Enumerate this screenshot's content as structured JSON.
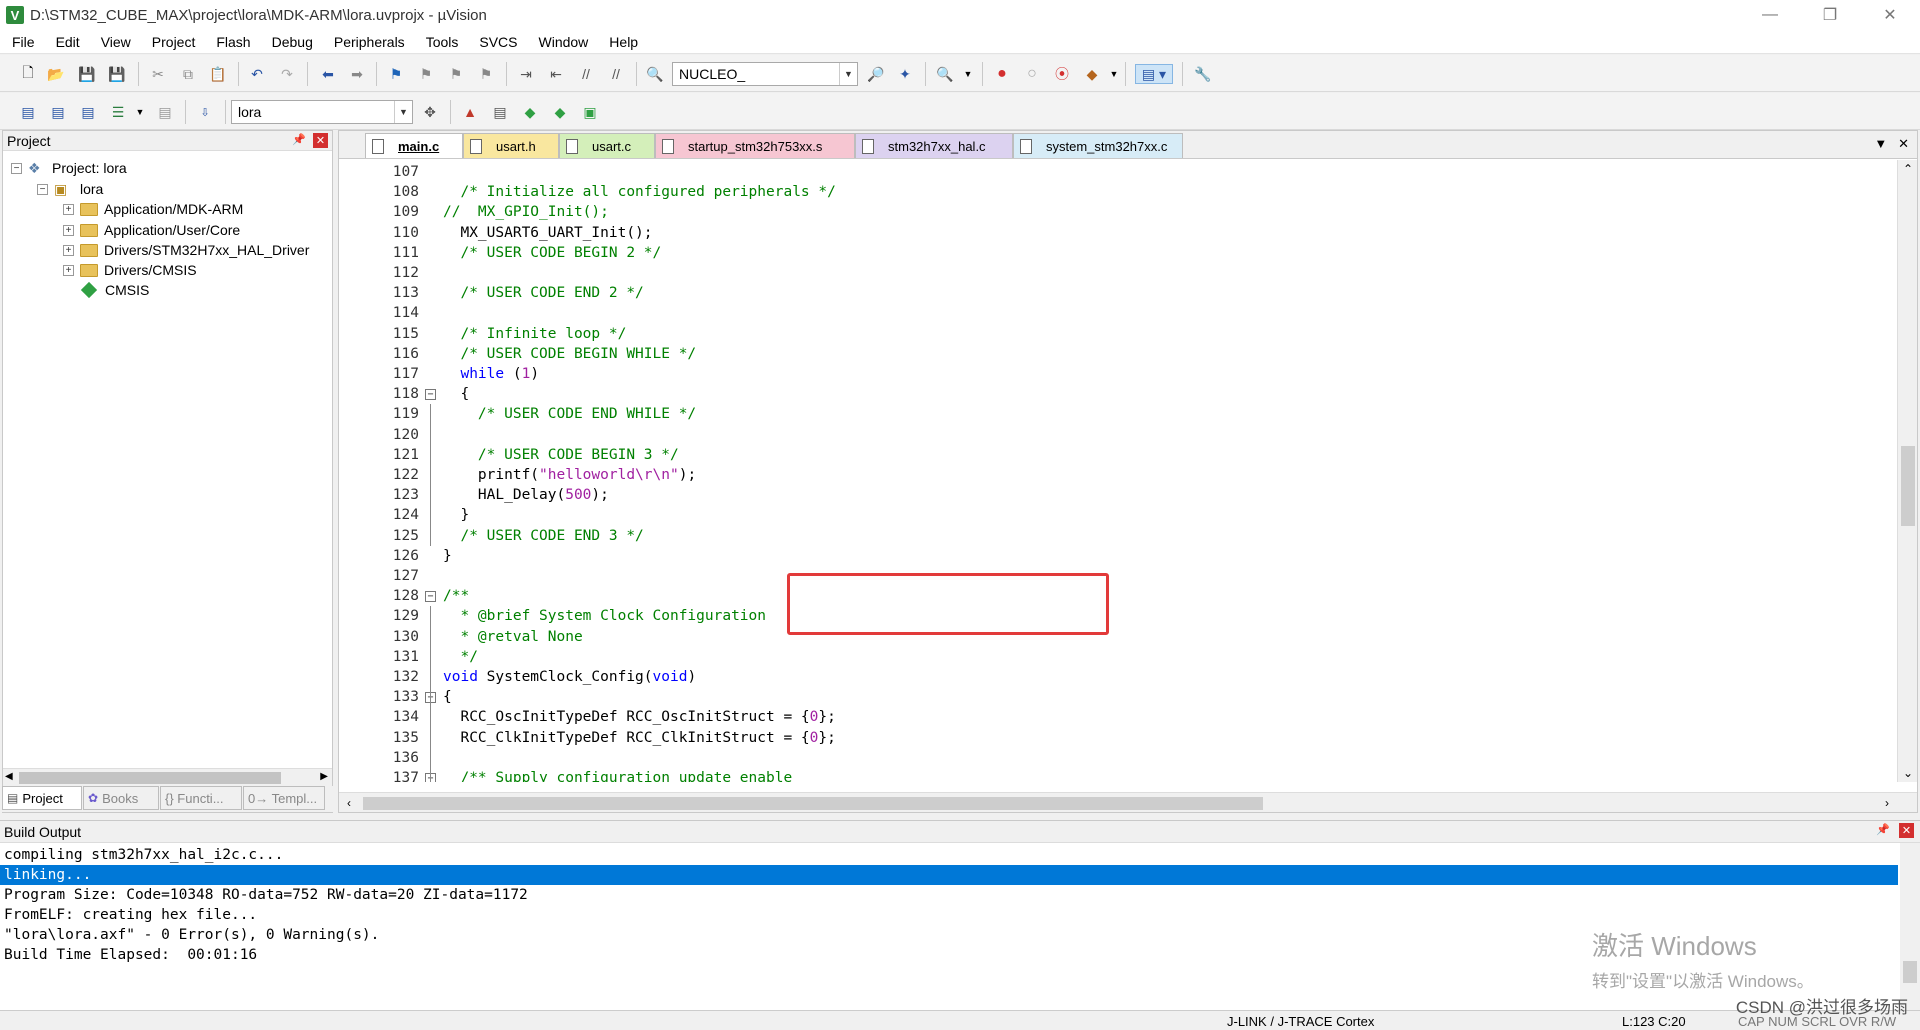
{
  "window": {
    "title": "D:\\STM32_CUBE_MAX\\project\\lora\\MDK-ARM\\lora.uvprojx - µVision",
    "app_icon": "V"
  },
  "menu": [
    "File",
    "Edit",
    "View",
    "Project",
    "Flash",
    "Debug",
    "Peripherals",
    "Tools",
    "SVCS",
    "Window",
    "Help"
  ],
  "toolbar": {
    "target_combo": "NUCLEO_",
    "project_combo": "lora"
  },
  "project_panel": {
    "title": "Project",
    "root": "Project: lora",
    "target": "lora",
    "groups": [
      "Application/MDK-ARM",
      "Application/User/Core",
      "Drivers/STM32H7xx_HAL_Driver",
      "Drivers/CMSIS"
    ],
    "component": "CMSIS",
    "bottom_tabs": [
      "Project",
      "Books",
      "{} Functi...",
      "0→ Templ..."
    ]
  },
  "editor": {
    "tabs": [
      "main.c",
      "usart.h",
      "usart.c",
      "startup_stm32h753xx.s",
      "stm32h7xx_hal.c",
      "system_stm32h7xx.c"
    ],
    "active_tab": "main.c",
    "lines": [
      {
        "n": "107",
        "t": ""
      },
      {
        "n": "108",
        "t": "  /* Initialize all configured peripherals */"
      },
      {
        "n": "109",
        "t": "//  MX_GPIO_Init();"
      },
      {
        "n": "110",
        "t": "  MX_USART6_UART_Init();"
      },
      {
        "n": "111",
        "t": "  /* USER CODE BEGIN 2 */"
      },
      {
        "n": "112",
        "t": ""
      },
      {
        "n": "113",
        "t": "  /* USER CODE END 2 */"
      },
      {
        "n": "114",
        "t": ""
      },
      {
        "n": "115",
        "t": "  /* Infinite loop */"
      },
      {
        "n": "116",
        "t": "  /* USER CODE BEGIN WHILE */"
      },
      {
        "n": "117",
        "t": "  while (1)"
      },
      {
        "n": "118",
        "t": "  {"
      },
      {
        "n": "119",
        "t": "    /* USER CODE END WHILE */"
      },
      {
        "n": "120",
        "t": ""
      },
      {
        "n": "121",
        "t": "    /* USER CODE BEGIN 3 */"
      },
      {
        "n": "122",
        "t": "    printf(\"helloworld\\r\\n\");"
      },
      {
        "n": "123",
        "t": "    HAL_Delay(500);"
      },
      {
        "n": "124",
        "t": "  }"
      },
      {
        "n": "125",
        "t": "  /* USER CODE END 3 */"
      },
      {
        "n": "126",
        "t": "}"
      },
      {
        "n": "127",
        "t": ""
      },
      {
        "n": "128",
        "t": "/**"
      },
      {
        "n": "129",
        "t": "  * @brief System Clock Configuration"
      },
      {
        "n": "130",
        "t": "  * @retval None"
      },
      {
        "n": "131",
        "t": "  */"
      },
      {
        "n": "132",
        "t": "void SystemClock_Config(void)"
      },
      {
        "n": "133",
        "t": "{"
      },
      {
        "n": "134",
        "t": "  RCC_OscInitTypeDef RCC_OscInitStruct = {0};"
      },
      {
        "n": "135",
        "t": "  RCC_ClkInitTypeDef RCC_ClkInitStruct = {0};"
      },
      {
        "n": "136",
        "t": ""
      },
      {
        "n": "137",
        "t": "  /** Supply configuration update enable"
      }
    ]
  },
  "build_output": {
    "title": "Build Output",
    "lines": [
      "compiling stm32h7xx_hal_i2c.c...",
      "linking...",
      "Program Size: Code=10348 RO-data=752 RW-data=20 ZI-data=1172",
      "FromELF: creating hex file...",
      "\"lora\\lora.axf\" - 0 Error(s), 0 Warning(s).",
      "Build Time Elapsed:  00:01:16"
    ],
    "selected_index": 1,
    "watermark_line1": "激活 Windows",
    "watermark_line2": "转到\"设置\"以激活 Windows。"
  },
  "status": {
    "debugger": "J-LINK / J-TRACE Cortex",
    "cursor": "L:123 C:20",
    "flags": "CAP  NUM  SCRL  OVR  R/W",
    "csdn": "CSDN @洪过很多场雨"
  },
  "colors": {
    "comment": "#008000",
    "keyword": "#0000ff",
    "string": "#a020a0",
    "highlight_box": "#e23a3a",
    "selection": "#0078d7"
  }
}
